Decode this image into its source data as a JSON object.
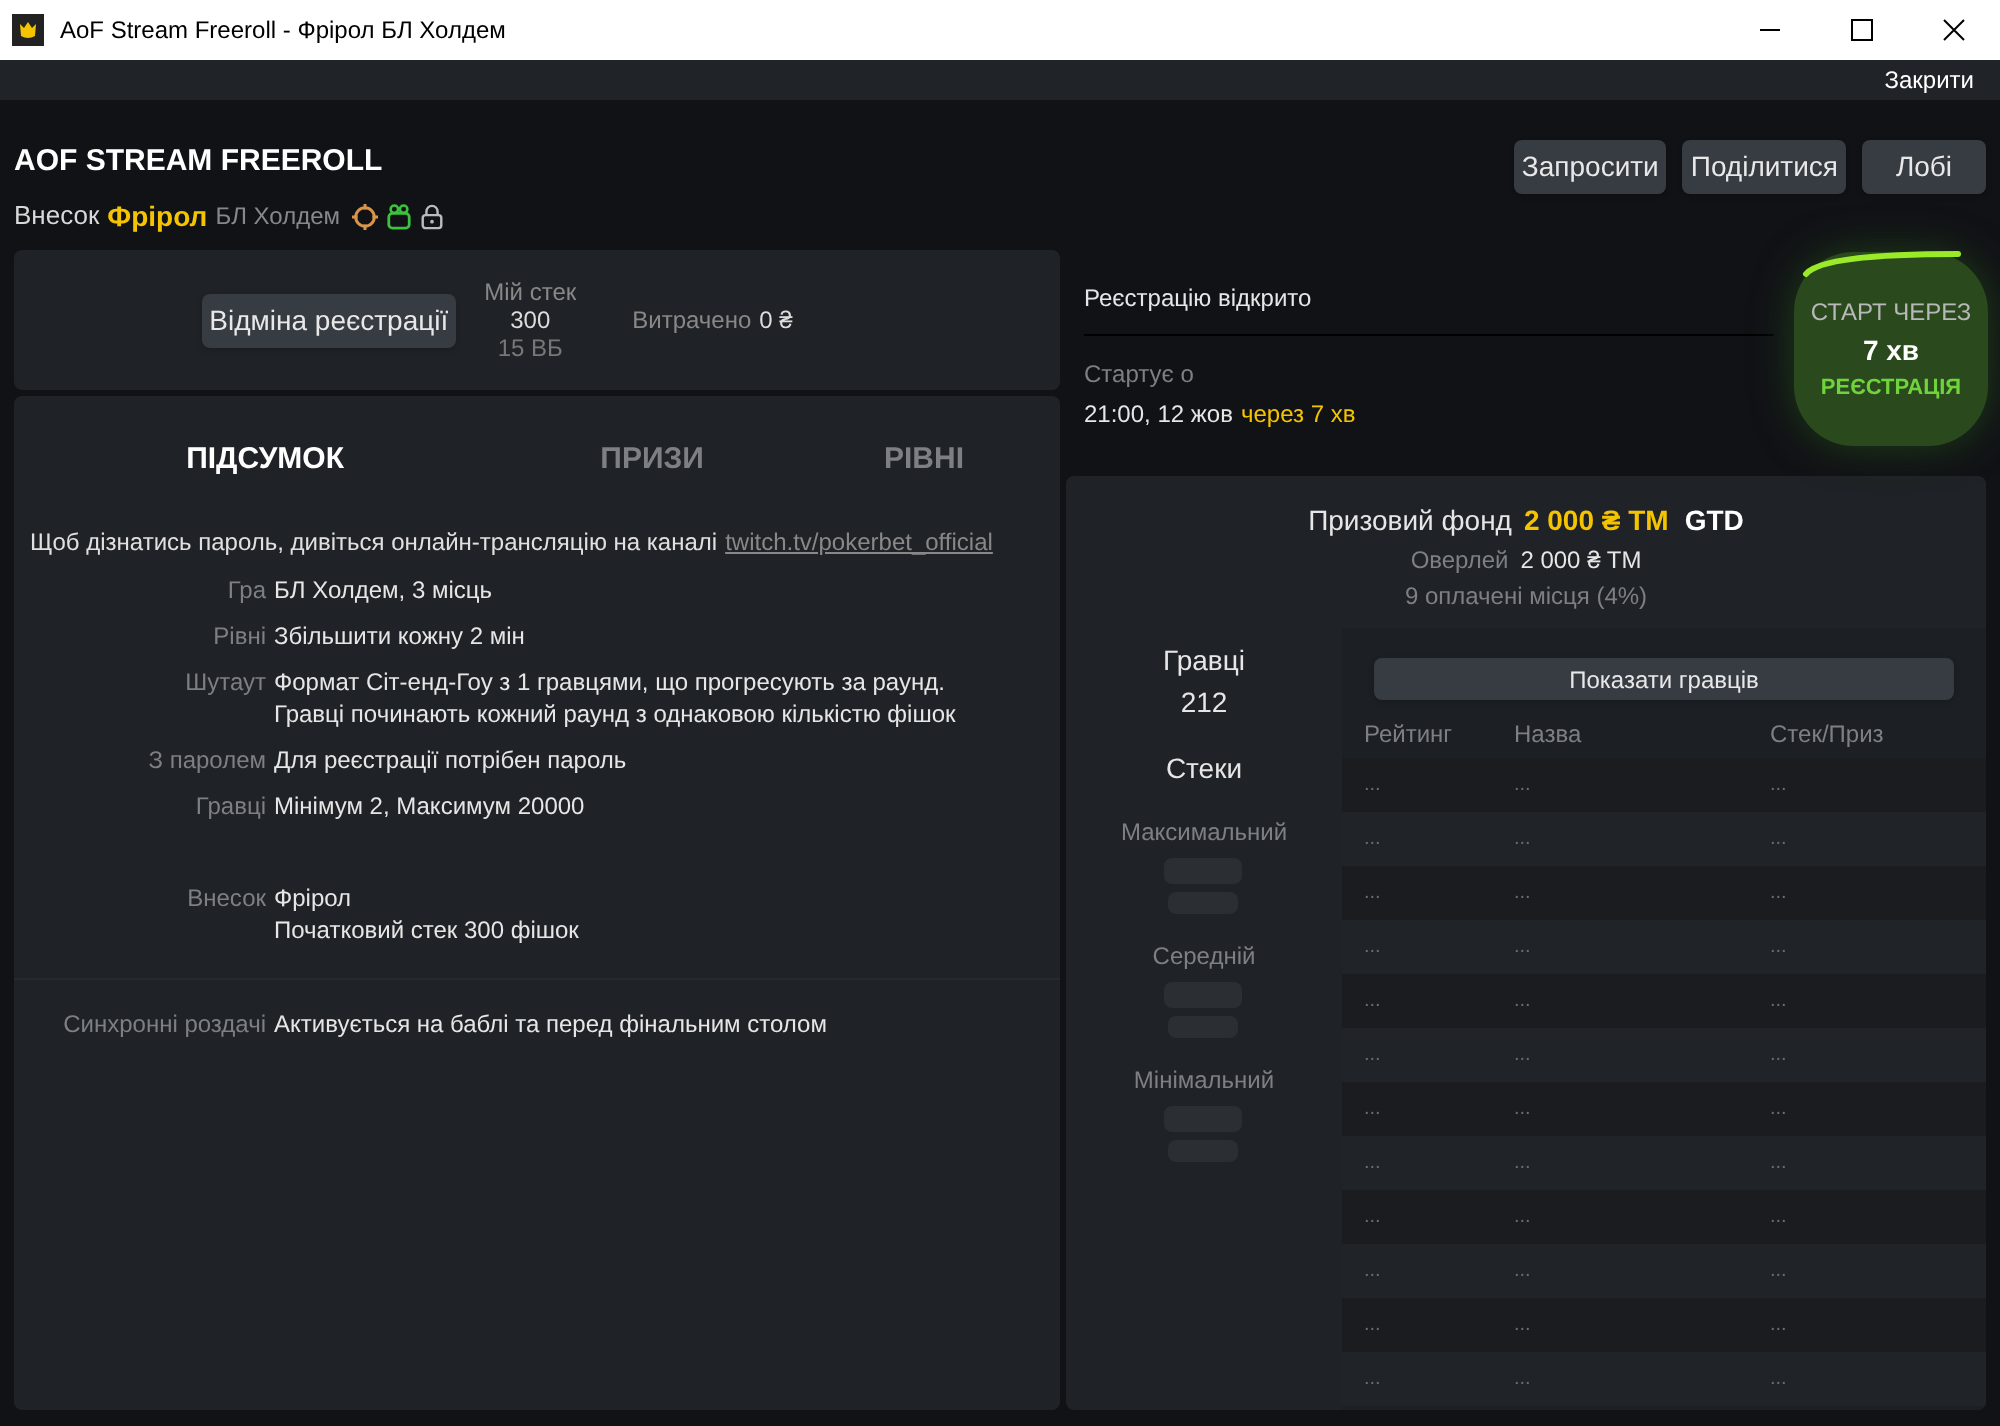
{
  "window": {
    "title": "AoF Stream Freeroll - Фрірол БЛ Холдем"
  },
  "top_bar": {
    "close_link": "Закрити"
  },
  "header": {
    "title": "AOF STREAM FREEROLL",
    "buyin_label": "Внесок",
    "buyin_value": "Фрірол",
    "game": "БЛ Холдем",
    "buttons": [
      "Запросити",
      "Поділитися",
      "Лобі"
    ]
  },
  "registration": {
    "button": "Відміна реєстрації",
    "stack_label": "Мій стек",
    "stack_value": "300",
    "stack_bb": "15 ВБ",
    "spent_label": "Витрачено",
    "spent_value": "0 ₴"
  },
  "tabs": [
    {
      "label": "ПІДСУМОК",
      "selected": true
    },
    {
      "label": "ПРИЗИ",
      "selected": false
    },
    {
      "label": "РІВНІ",
      "selected": false
    }
  ],
  "summary": {
    "note": "Щоб дізнатись пароль, дивіться онлайн-трансляцію на каналі",
    "link": "twitch.tv/pokerbet_official",
    "groups": [
      [
        {
          "label": "Гра",
          "lines": [
            "БЛ Холдем, 3 місць"
          ]
        },
        {
          "label": "Рівні",
          "lines": [
            "Збільшити кожну 2 мін"
          ]
        },
        {
          "label": "Шутаут",
          "lines": [
            "Формат Сіт-енд-Гоу з 1 гравцями, що прогресують за раунд.",
            "Гравці починають кожний раунд з однаковою кількістю фішок"
          ]
        },
        {
          "label": "З паролем",
          "lines": [
            "Для реєстрації потрібен пароль"
          ]
        },
        {
          "label": "Гравці",
          "lines": [
            "Мінімум 2, Максимум 20000"
          ]
        }
      ],
      [
        {
          "label": "Внесок",
          "lines": [
            "Фрірол",
            "Початковий стек 300 фішок"
          ]
        }
      ],
      [
        {
          "label": "Синхронні роздачі",
          "lines": [
            "Активується на баблі та перед фінальним столом"
          ]
        }
      ]
    ]
  },
  "status": {
    "state": "Реєстрацію відкрито",
    "start_label": "Стартує о",
    "start_time": "21:00, 12 жов",
    "start_in": "через 7 хв"
  },
  "timer": {
    "label": "СТАРТ ЧЕРЕЗ",
    "value": "7 хв",
    "state": "РЕЄСТРАЦІЯ"
  },
  "prize": {
    "label": "Призовий фонд",
    "amount": "2 000 ₴ TM",
    "gtd": "GTD",
    "overlay_label": "Оверлей",
    "overlay_value": "2 000 ₴ TM",
    "paid": "9 оплачені місця (4%)"
  },
  "players": {
    "label": "Гравці",
    "count": "212",
    "stacks_title": "Стеки",
    "stacks": [
      "Максимальний",
      "Середній",
      "Мінімальний"
    ],
    "show_button": "Показати гравців",
    "columns": [
      "Рейтинг",
      "Назва",
      "Стек/Приз"
    ],
    "rows": [
      [
        "...",
        "...",
        "..."
      ],
      [
        "...",
        "...",
        "..."
      ],
      [
        "...",
        "...",
        "..."
      ],
      [
        "...",
        "...",
        "..."
      ],
      [
        "...",
        "...",
        "..."
      ],
      [
        "...",
        "...",
        "..."
      ],
      [
        "...",
        "...",
        "..."
      ],
      [
        "...",
        "...",
        "..."
      ],
      [
        "...",
        "...",
        "..."
      ],
      [
        "...",
        "...",
        "..."
      ],
      [
        "...",
        "...",
        "..."
      ],
      [
        "...",
        "...",
        "..."
      ]
    ]
  }
}
